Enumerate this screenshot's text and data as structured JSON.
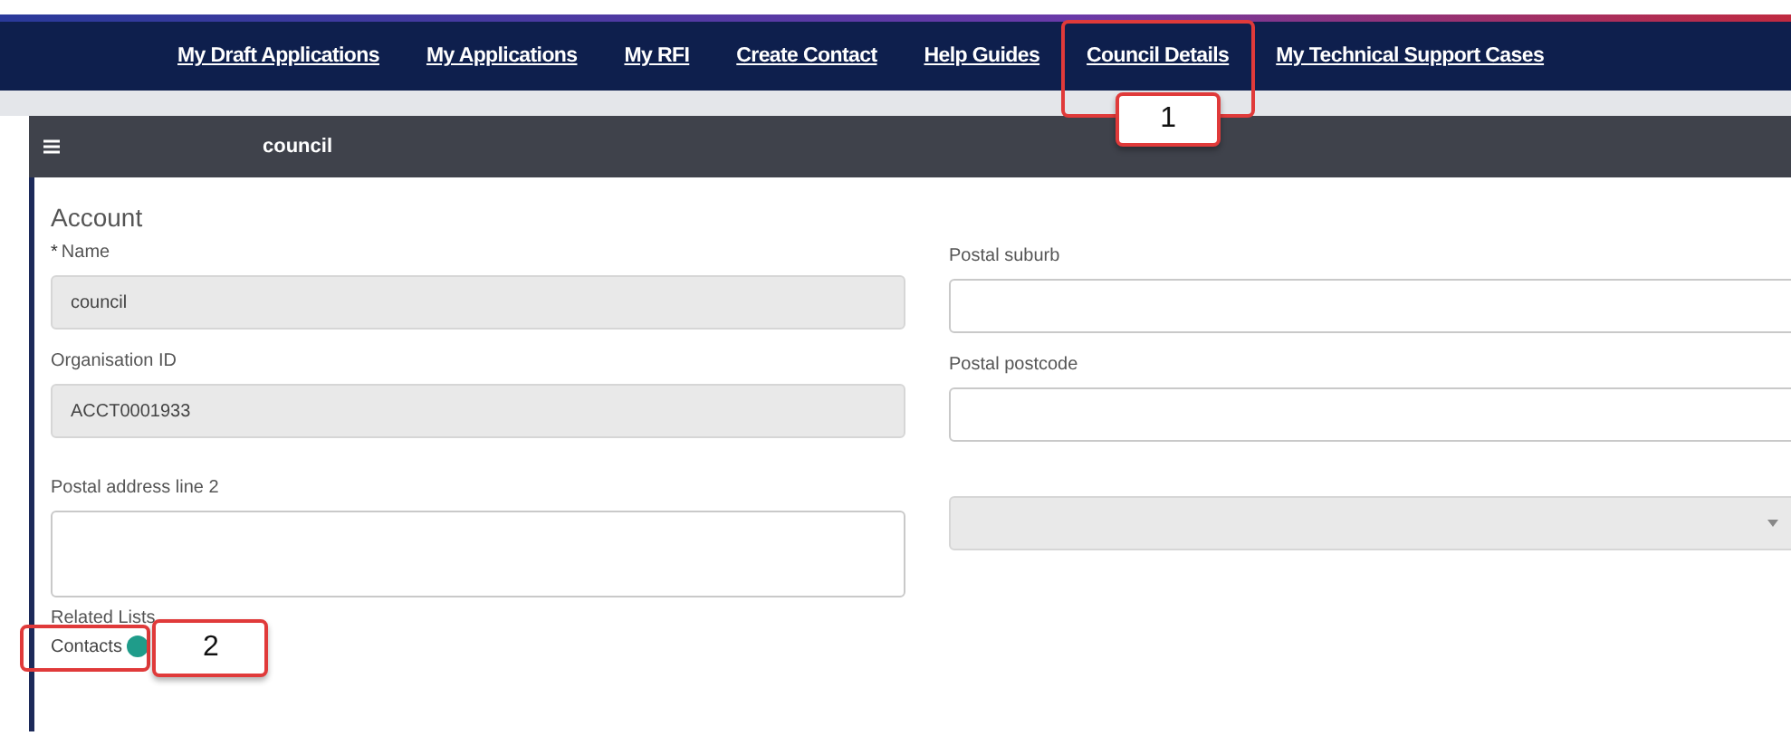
{
  "nav": {
    "links": [
      {
        "label": "My Draft Applications"
      },
      {
        "label": "My Applications"
      },
      {
        "label": "My RFI"
      },
      {
        "label": "Create Contact"
      },
      {
        "label": "Help Guides"
      },
      {
        "label": "Council Details"
      },
      {
        "label": "My Technical Support Cases"
      }
    ]
  },
  "header": {
    "title": "council"
  },
  "form": {
    "section_title": "Account",
    "left_fields": [
      {
        "label": "Name",
        "marker": "*",
        "value": "council",
        "kind": "input",
        "readonly": true
      },
      {
        "label": "Organisation ID",
        "value": "ACCT0001933",
        "kind": "input",
        "readonly": true
      },
      {
        "label": "Postal address line 2",
        "kind": "textarea",
        "readonly": false
      }
    ],
    "right_fields": [
      {
        "label": "Postal suburb",
        "kind": "input"
      },
      {
        "label": "Postal postcode",
        "kind": "input"
      },
      {
        "kind": "select"
      }
    ]
  },
  "related_lists": {
    "title": "Related Lists",
    "items": [
      {
        "label": "Contacts"
      }
    ]
  },
  "annotations": [
    {
      "number": "1"
    },
    {
      "number": "2"
    }
  ]
}
